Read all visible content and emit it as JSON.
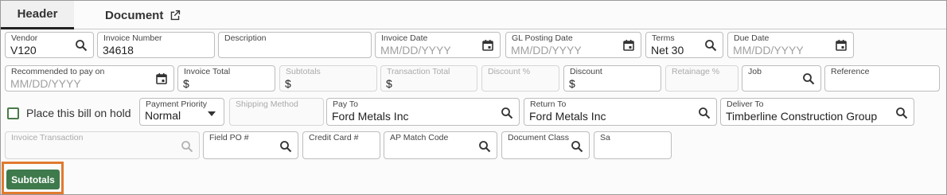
{
  "tabs": [
    {
      "label": "Header"
    },
    {
      "label": "Document"
    }
  ],
  "fields": {
    "vendor": {
      "label": "Vendor",
      "value": "V120"
    },
    "invoice_number": {
      "label": "Invoice Number",
      "value": "34618"
    },
    "description": {
      "label": "Description",
      "value": ""
    },
    "invoice_date": {
      "label": "Invoice Date",
      "placeholder": "MM/DD/YYYY"
    },
    "gl_posting_date": {
      "label": "GL Posting Date",
      "placeholder": "MM/DD/YYYY"
    },
    "terms": {
      "label": "Terms",
      "value": "Net 30"
    },
    "due_date": {
      "label": "Due Date",
      "placeholder": "MM/DD/YYYY"
    },
    "recommended_pay": {
      "label": "Recommended to pay on",
      "placeholder": "MM/DD/YYYY"
    },
    "invoice_total": {
      "label": "Invoice Total",
      "value": "$"
    },
    "subtotals": {
      "label": "Subtotals",
      "value": "$"
    },
    "transaction_total": {
      "label": "Transaction Total",
      "value": "$"
    },
    "discount_pct": {
      "label": "Discount %",
      "value": ""
    },
    "discount": {
      "label": "Discount",
      "value": "$"
    },
    "retainage_pct": {
      "label": "Retainage %",
      "value": ""
    },
    "job": {
      "label": "Job",
      "value": ""
    },
    "reference": {
      "label": "Reference",
      "value": ""
    },
    "hold": {
      "label": "Place this bill on hold"
    },
    "payment_priority": {
      "label": "Payment Priority",
      "value": "Normal"
    },
    "shipping_method": {
      "label": "Shipping Method",
      "value": ""
    },
    "pay_to": {
      "label": "Pay To",
      "value": "Ford Metals Inc"
    },
    "return_to": {
      "label": "Return To",
      "value": "Ford Metals Inc"
    },
    "deliver_to": {
      "label": "Deliver To",
      "value": "Timberline Construction Group"
    },
    "invoice_transaction": {
      "label": "Invoice Transaction",
      "value": ""
    },
    "field_po": {
      "label": "Field PO #",
      "value": ""
    },
    "credit_card": {
      "label": "Credit Card #",
      "value": ""
    },
    "ap_match_code": {
      "label": "AP Match Code",
      "value": ""
    },
    "document_class": {
      "label": "Document Class",
      "value": ""
    },
    "sa": {
      "label": "Sa",
      "value": ""
    }
  },
  "buttons": {
    "subtotals": "Subtotals"
  },
  "colors": {
    "accent_green": "#3f7a4c",
    "highlight_orange": "#e07a2f"
  }
}
